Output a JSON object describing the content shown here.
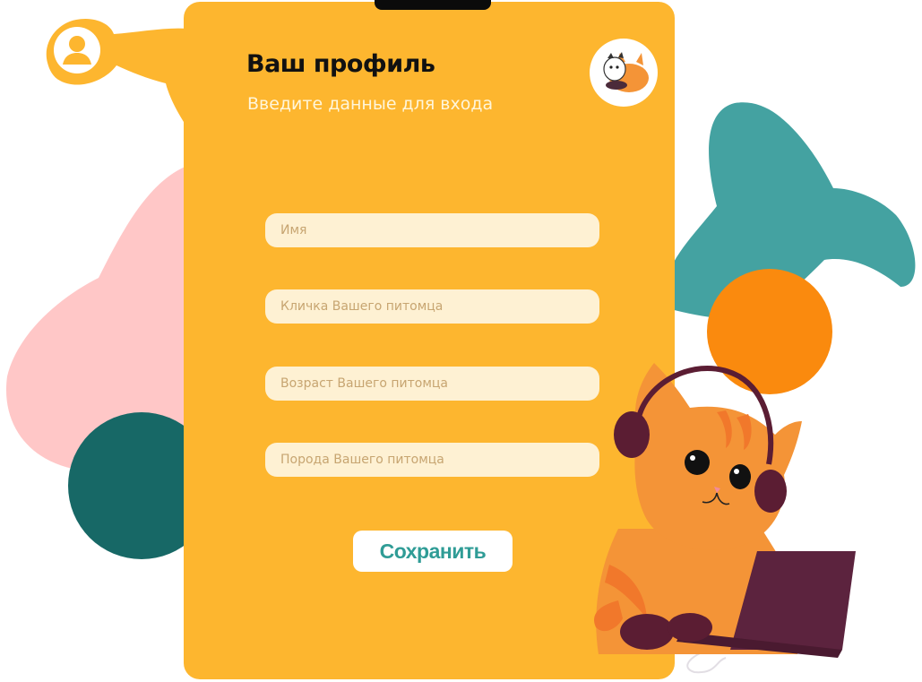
{
  "colors": {
    "card": "#FDB62F",
    "field_bg": "#FEF1D3",
    "button_text": "#2F9C96",
    "pink_blob": "#FFC7C7",
    "teal_blob": "#44A2A1",
    "dark_teal_circle": "#176866",
    "orange_circle": "#FA8A0E",
    "cat_orange": "#F49437",
    "headphones": "#5B1D33",
    "laptop": "#5C233E"
  },
  "header": {
    "title": "Ваш профиль",
    "subtitle": "Введите данные для входа"
  },
  "icons": {
    "user": "user-icon",
    "logo": "cat-logo-avatar"
  },
  "form": {
    "fields": [
      {
        "placeholder": "Имя",
        "value": ""
      },
      {
        "placeholder": "Кличка Вашего питомца",
        "value": ""
      },
      {
        "placeholder": "Возраст Вашего питомца",
        "value": ""
      },
      {
        "placeholder": "Порода Вашего питомца",
        "value": ""
      }
    ],
    "save_label": "Сохранить"
  },
  "illustration": "cat-with-headphones-and-laptop"
}
